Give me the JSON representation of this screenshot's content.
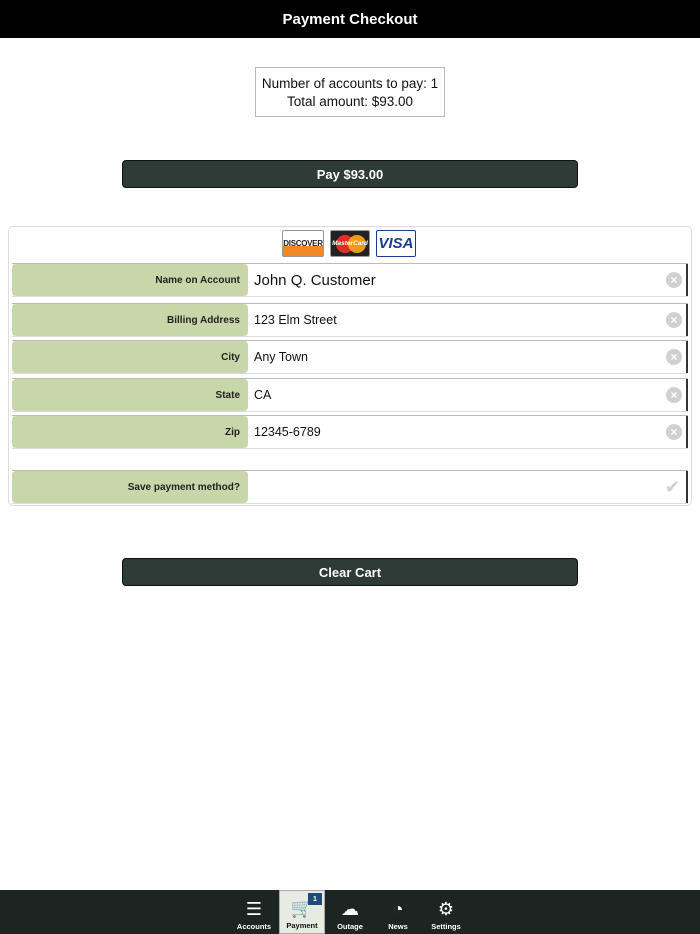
{
  "header": {
    "title": "Payment Checkout"
  },
  "summary": {
    "accounts_line": "Number of accounts to pay: 1",
    "total_line": "Total amount: $93.00"
  },
  "pay_button": {
    "label": "Pay $93.00"
  },
  "card_logos": [
    "DISCOVER",
    "MasterCard",
    "VISA"
  ],
  "form": {
    "name": {
      "label": "Name on Account",
      "value": "John Q. Customer"
    },
    "address": {
      "label": "Billing Address",
      "value": "123 Elm Street"
    },
    "city": {
      "label": "City",
      "value": "Any Town"
    },
    "state": {
      "label": "State",
      "value": "CA"
    },
    "zip": {
      "label": "Zip",
      "value": "12345-6789"
    },
    "save": {
      "label": "Save payment method?",
      "checked": false
    }
  },
  "clear_button": {
    "label": "Clear Cart"
  },
  "tabs": [
    {
      "label": "Accounts",
      "icon": "list-icon"
    },
    {
      "label": "Payment",
      "icon": "cart-icon",
      "badge": "1",
      "active": true
    },
    {
      "label": "Outage",
      "icon": "cloud-lightning-icon"
    },
    {
      "label": "News",
      "icon": "rss-icon"
    },
    {
      "label": "Settings",
      "icon": "gear-icon"
    }
  ],
  "colors": {
    "header_bg": "#000000",
    "button_bg": "#2e3b37",
    "label_bg": "#c8d7a9",
    "tabbar_bg": "#1c2521",
    "badge_bg": "#1f4a7a"
  }
}
